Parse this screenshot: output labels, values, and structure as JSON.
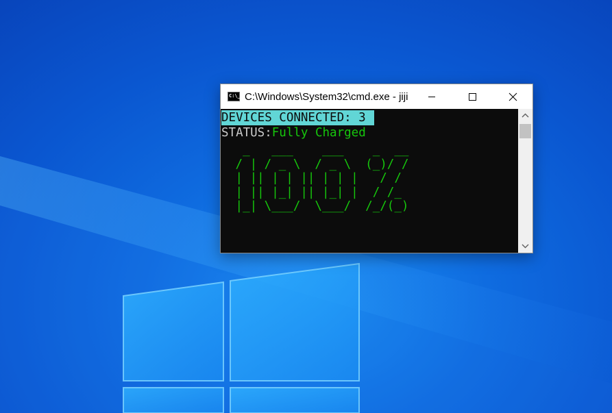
{
  "desktop": {
    "background_color": "#0a56d0",
    "logo": "windows-logo"
  },
  "window": {
    "title": "C:\\Windows\\System32\\cmd.exe - jiji",
    "icon": "cmd-icon",
    "icon_text": "C:\\_",
    "controls": {
      "minimize": "minimize-icon",
      "maximize": "maximize-icon",
      "close": "close-icon"
    }
  },
  "console": {
    "devices_line": "DEVICES CONNECTED: 3",
    "status_label": "STATUS:",
    "status_value": "Fully Charged",
    "ascii_art": "  _   ___    ___    _  __\n / | / _ \\  / _ \\  (_)/ /\n | || | | || | | |   / / \n | || |_| || |_| |  / /_ \n |_| \\___/  \\___/  /_/(_)",
    "colors": {
      "background": "#0c0c0c",
      "highlight_bg": "#61d6d6",
      "green": "#16c60c",
      "gray": "#cccccc"
    }
  },
  "scrollbar": {
    "up_icon": "chevron-up-icon",
    "down_icon": "chevron-down-icon"
  }
}
